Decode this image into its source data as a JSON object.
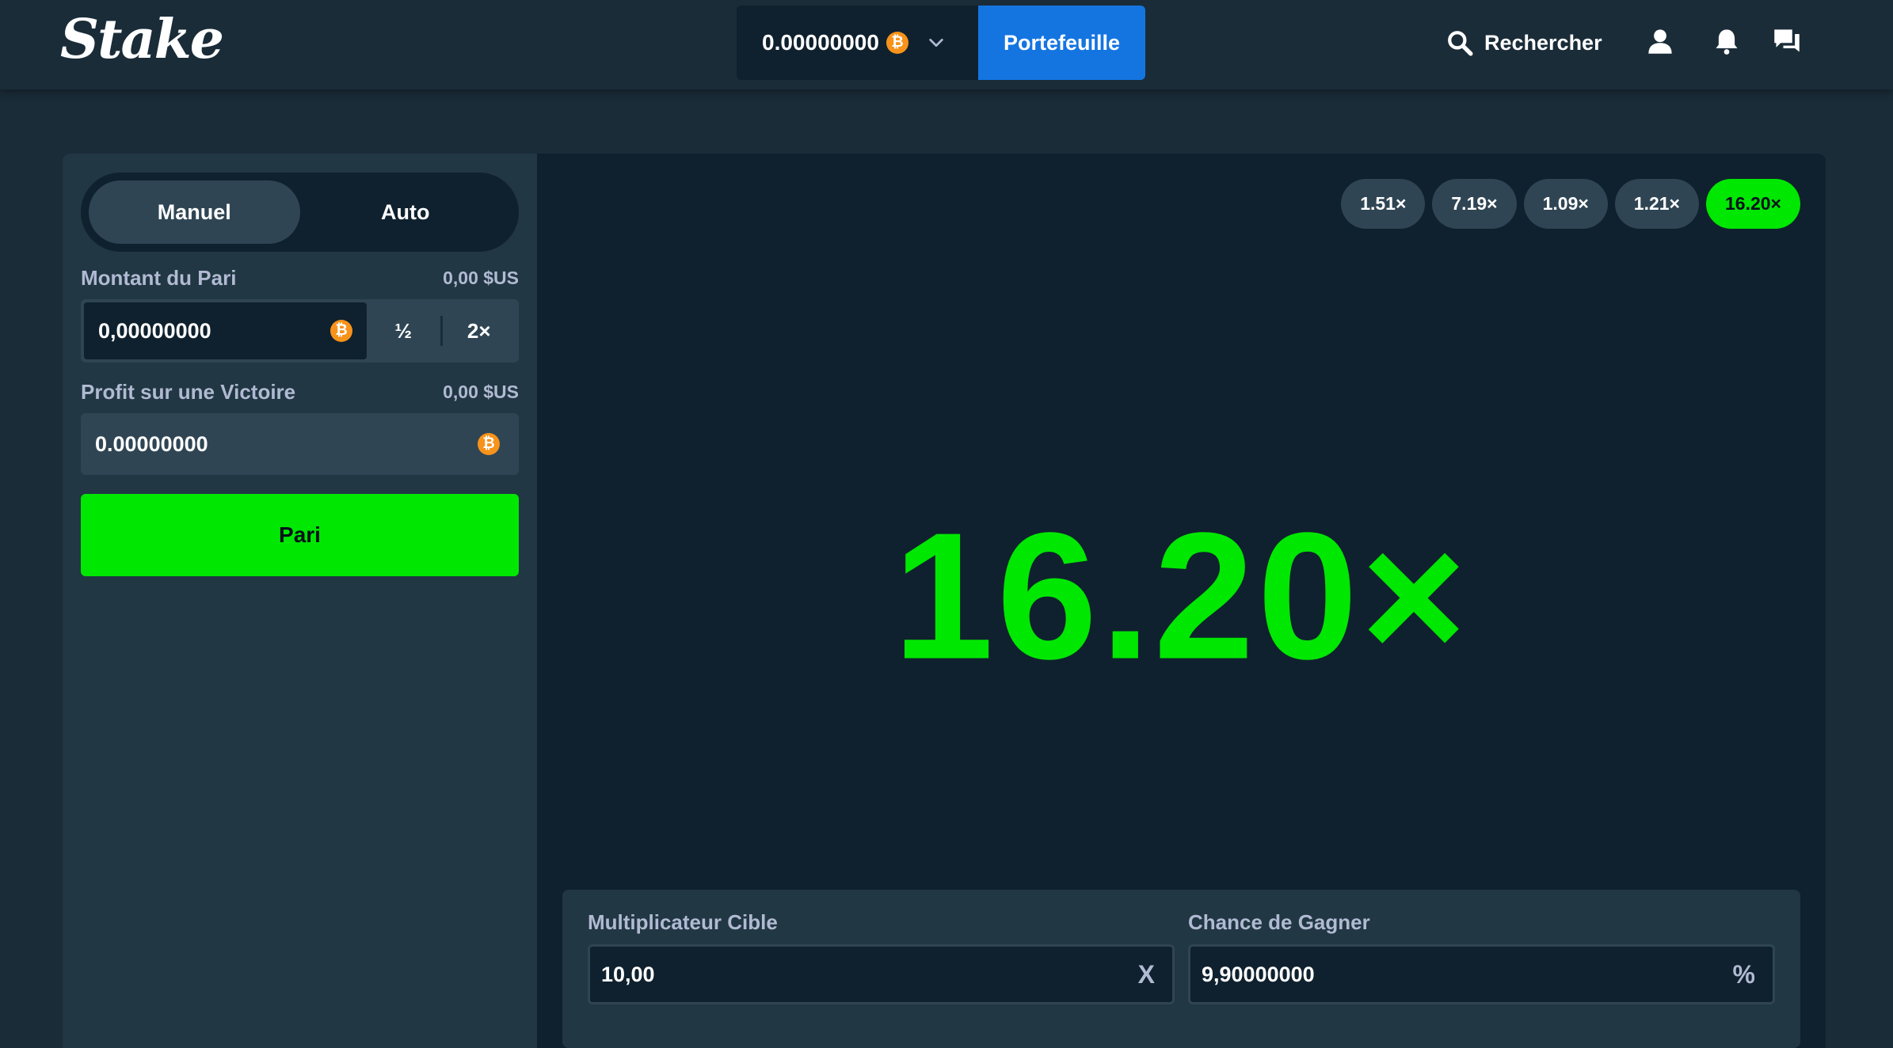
{
  "header": {
    "logo": "Stake",
    "balance": "0.00000000",
    "currency_symbol": "₿",
    "wallet_label": "Portefeuille",
    "search_label": "Rechercher"
  },
  "sidebar": {
    "tabs": [
      {
        "label": "Manuel",
        "active": true
      },
      {
        "label": "Auto",
        "active": false
      }
    ],
    "bet_amount": {
      "label": "Montant du Pari",
      "usd_value": "0,00 $US",
      "value": "0,00000000",
      "half_label": "½",
      "double_label": "2×"
    },
    "profit": {
      "label": "Profit sur une Victoire",
      "usd_value": "0,00 $US",
      "value": "0.00000000"
    },
    "bet_button_label": "Pari"
  },
  "board": {
    "history": [
      "1.51×",
      "7.19×",
      "1.09×",
      "1.21×",
      "16.20×"
    ],
    "result": "16.20×",
    "target_multiplier": {
      "label": "Multiplicateur Cible",
      "value": "10,00",
      "suffix": "X"
    },
    "win_chance": {
      "label": "Chance de Gagner",
      "value": "9,90000000",
      "suffix": "%"
    }
  },
  "colors": {
    "accent_green": "#00e701",
    "wallet_blue": "#1475e1",
    "bitcoin_orange": "#f7931a"
  }
}
